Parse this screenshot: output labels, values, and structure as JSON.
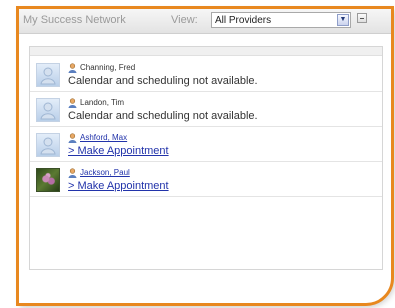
{
  "widget": {
    "title": "My Success Network",
    "view_label": "View:",
    "view_value": "All Providers",
    "accent_color": "#e8881f"
  },
  "providers": [
    {
      "name": "Channing, Fred",
      "status": "Calendar and scheduling not available.",
      "name_link": false,
      "avatar": "default-avatar"
    },
    {
      "name": "Landon, Tim",
      "status": "Calendar and scheduling not available.",
      "name_link": false,
      "avatar": "default-avatar"
    },
    {
      "name": "Ashford, Max",
      "status": "> Make Appointment",
      "name_link": true,
      "avatar": "default-avatar"
    },
    {
      "name": "Jackson, Paul",
      "status": "> Make Appointment",
      "name_link": true,
      "avatar": "flower-photo"
    }
  ]
}
